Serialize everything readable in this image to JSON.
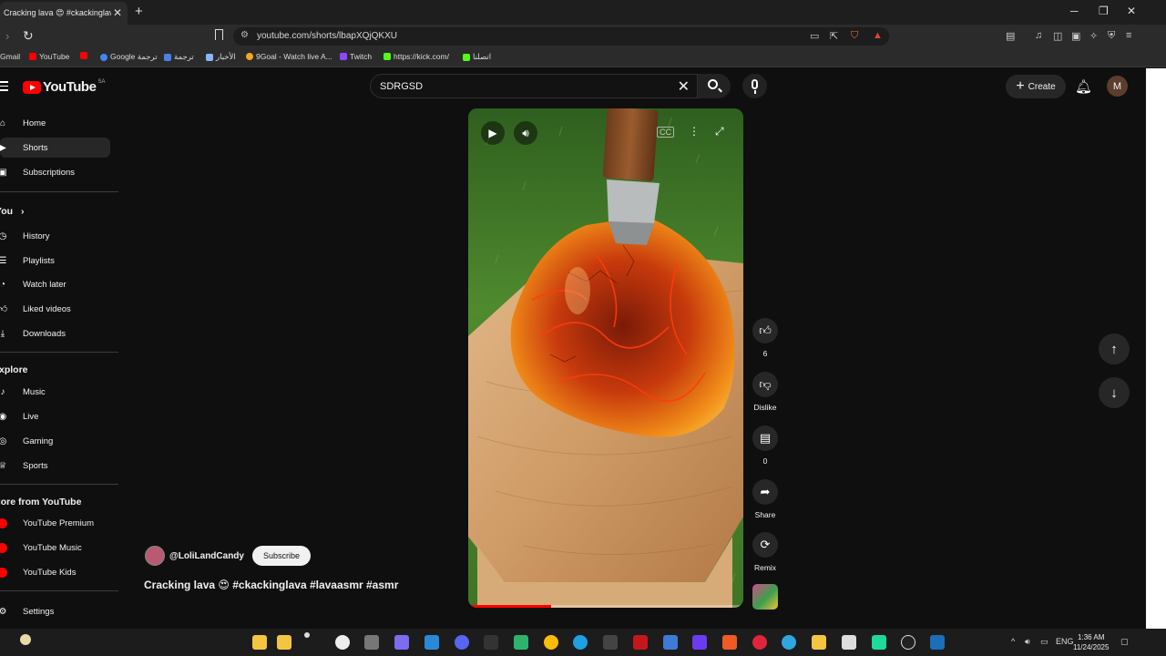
{
  "browser": {
    "tab_title": "Cracking lava 😍 #ckackinglava",
    "url": "youtube.com/shorts/lbapXQjQKXU",
    "bookmarks": [
      "Gmail",
      "YouTube",
      "Google ترجمة",
      "ترجمة",
      "الأخبار",
      "9Goal - Watch live A...",
      "Twitch",
      "https://kick.com/",
      "اتصلنا"
    ]
  },
  "youtube": {
    "logo_text": "YouTube",
    "logo_country": "SA",
    "search_query": "SDRGSD",
    "create_label": "Create",
    "avatar_letter": "M",
    "sidebar": {
      "main": [
        "Home",
        "Shorts",
        "Subscriptions"
      ],
      "you_heading": "You",
      "you": [
        "History",
        "Playlists",
        "Watch later",
        "Liked videos",
        "Downloads"
      ],
      "explore_heading": "Explore",
      "explore": [
        "Music",
        "Live",
        "Gaming",
        "Sports"
      ],
      "more_heading": "More from YouTube",
      "more": [
        "YouTube Premium",
        "YouTube Music",
        "YouTube Kids"
      ],
      "settings": "Settings"
    },
    "short": {
      "channel": "@LoliLandCandy",
      "subscribe_label": "Subscribe",
      "caption": "Cracking lava 😍 #ckackinglava #lavaasmr #asmr",
      "progress": 0.3,
      "actions": {
        "like_count": "6",
        "dislike_label": "Dislike",
        "comment_count": "0",
        "share_label": "Share",
        "remix_label": "Remix"
      }
    }
  },
  "taskbar": {
    "lang": "ENG",
    "time": "1:36 AM",
    "date": "11/24/2025"
  }
}
